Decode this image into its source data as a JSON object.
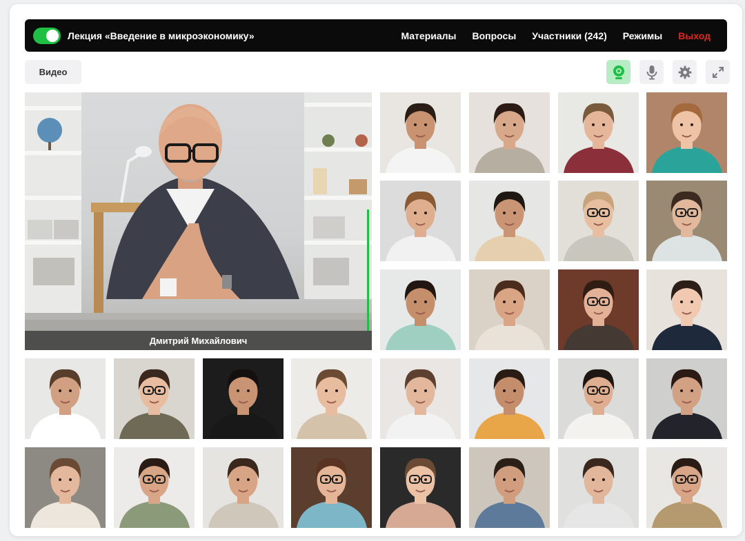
{
  "header": {
    "toggle_on": true,
    "lecture_title": "Лекция «Введение в микроэкономику»",
    "nav": [
      {
        "id": "materials",
        "label": "Материалы"
      },
      {
        "id": "questions",
        "label": "Вопросы"
      },
      {
        "id": "participants",
        "label": "Участники (242)"
      },
      {
        "id": "modes",
        "label": "Режимы"
      },
      {
        "id": "exit",
        "label": "Выход"
      }
    ]
  },
  "toolbar": {
    "video_label": "Видео",
    "icons": [
      "camera-icon",
      "microphone-icon",
      "gear-icon",
      "expand-icon"
    ]
  },
  "speaker": {
    "name": "Дмитрий Михайлович"
  },
  "colors": {
    "accent": "#1fbf44",
    "exit": "#e0271f",
    "header_bg": "#0b0b0b",
    "camera_active_bg": "#b7ecc4"
  },
  "participants": [
    {
      "bg": "#e9e6e2",
      "skin": "#c99372",
      "hair": "#2a1d16",
      "shirt": "#f4f4f4",
      "glasses": false
    },
    {
      "bg": "#e6e1dc",
      "skin": "#d7a889",
      "hair": "#2b1b14",
      "shirt": "#b7aea2",
      "glasses": false
    },
    {
      "bg": "#e8e9e4",
      "skin": "#e5b69a",
      "hair": "#7a5a3d",
      "shirt": "#8b2f3b",
      "glasses": false
    },
    {
      "bg": "#b0856a",
      "skin": "#efc3a6",
      "hair": "#a46a3d",
      "shirt": "#2aa39a",
      "glasses": false
    },
    {
      "bg": "#dcdcdc",
      "skin": "#deae8f",
      "hair": "#8a5a34",
      "shirt": "#f1f1f1",
      "glasses": false
    },
    {
      "bg": "#e6e6e4",
      "skin": "#c99574",
      "hair": "#1f1712",
      "shirt": "#e6cfae",
      "glasses": false
    },
    {
      "bg": "#e2dfd8",
      "skin": "#e8bea1",
      "hair": "#c8a47a",
      "shirt": "#c9c6bd",
      "glasses": true
    },
    {
      "bg": "#9a8a73",
      "skin": "#e1b89c",
      "hair": "#3a2a20",
      "shirt": "#dde3e2",
      "glasses": true
    },
    {
      "bg": "#e7e8e8",
      "skin": "#c68f6c",
      "hair": "#221611",
      "shirt": "#9ecfc0",
      "glasses": false
    },
    {
      "bg": "#dad2c6",
      "skin": "#d9a585",
      "hair": "#4a2d1c",
      "shirt": "#e9e2d9",
      "glasses": false
    },
    {
      "bg": "#6e3a2a",
      "skin": "#e3b296",
      "hair": "#2f1d14",
      "shirt": "#443a33",
      "glasses": true
    },
    {
      "bg": "#e8e2dc",
      "skin": "#f0c9b0",
      "hair": "#2d1f18",
      "shirt": "#1e2a3c",
      "glasses": false
    },
    {
      "bg": "#e8e8e6",
      "skin": "#d1a082",
      "hair": "#5a3e2c",
      "shirt": "#ffffff",
      "glasses": false
    },
    {
      "bg": "#d9d6cf",
      "skin": "#e8bca0",
      "hair": "#3b271d",
      "shirt": "#6f6a55",
      "glasses": true
    },
    {
      "bg": "#1c1c1c",
      "skin": "#c89473",
      "hair": "#141010",
      "shirt": "#181818",
      "glasses": false
    },
    {
      "bg": "#ecebe8",
      "skin": "#e7bc9f",
      "hair": "#6b4b34",
      "shirt": "#d4c3aa",
      "glasses": false
    },
    {
      "bg": "#eae6e3",
      "skin": "#e3b79c",
      "hair": "#5d4030",
      "shirt": "#f2f2f2",
      "glasses": false
    },
    {
      "bg": "#e6e7e8",
      "skin": "#c48e6c",
      "hair": "#2a1c14",
      "shirt": "#e8a648",
      "glasses": false
    },
    {
      "bg": "#dbdcda",
      "skin": "#dfae90",
      "hair": "#1e1612",
      "shirt": "#f4f2ef",
      "glasses": true
    },
    {
      "bg": "#cfcfcd",
      "skin": "#d2a083",
      "hair": "#2b1b14",
      "shirt": "#23232c",
      "glasses": false
    },
    {
      "bg": "#8d8a84",
      "skin": "#e3b89c",
      "hair": "#6a4a34",
      "shirt": "#ece6dd",
      "glasses": false
    },
    {
      "bg": "#ecebe9",
      "skin": "#d8a687",
      "hair": "#2a1c15",
      "shirt": "#8b9a78",
      "glasses": true
    },
    {
      "bg": "#e6e4e0",
      "skin": "#d7a586",
      "hair": "#3a281d",
      "shirt": "#cfc7ba",
      "glasses": false
    },
    {
      "bg": "#5b3e2e",
      "skin": "#e4b597",
      "hair": "#5a3322",
      "shirt": "#7db6c7",
      "glasses": true
    },
    {
      "bg": "#2a2a2a",
      "skin": "#ebc2a6",
      "hair": "#6b4a33",
      "shirt": "#d6a994",
      "glasses": true
    },
    {
      "bg": "#ccc6bc",
      "skin": "#d09e7f",
      "hair": "#2b1f18",
      "shirt": "#5d7a9b",
      "glasses": false
    },
    {
      "bg": "#e0e0de",
      "skin": "#e2b69a",
      "hair": "#3a281f",
      "shirt": "#e6e6e6",
      "glasses": false
    },
    {
      "bg": "#e9e7e3",
      "skin": "#d8a687",
      "hair": "#2a1c15",
      "shirt": "#b59a70",
      "glasses": true
    }
  ]
}
